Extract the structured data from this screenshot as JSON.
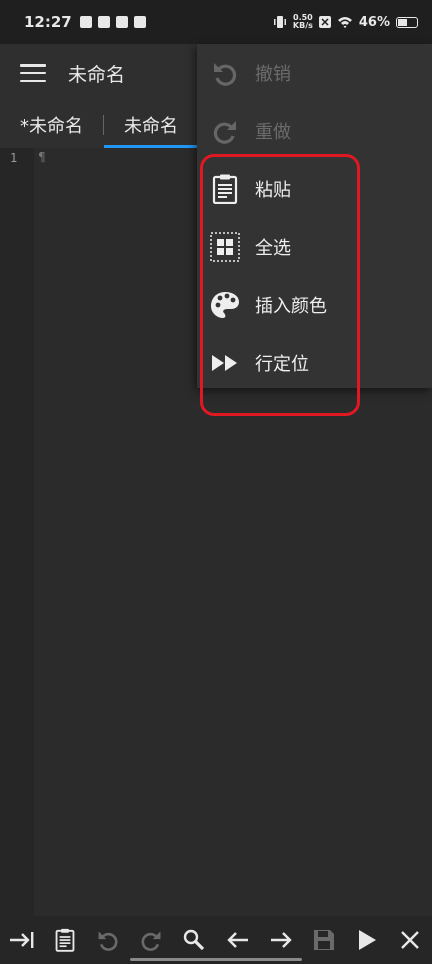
{
  "status_bar": {
    "time": "12:27",
    "speed_value": "0.50",
    "speed_unit": "KB/s",
    "battery": "46%"
  },
  "app_bar": {
    "title": "未命名"
  },
  "tabs": [
    {
      "label": "*未命名",
      "active": false
    },
    {
      "label": "未命名",
      "active": true
    }
  ],
  "editor": {
    "line_number": "1",
    "marker": "¶"
  },
  "menu": {
    "items": [
      {
        "label": "撤销",
        "icon": "undo-icon",
        "enabled": false
      },
      {
        "label": "重做",
        "icon": "redo-icon",
        "enabled": false
      },
      {
        "label": "粘贴",
        "icon": "clipboard-icon",
        "enabled": true
      },
      {
        "label": "全选",
        "icon": "select-all-icon",
        "enabled": true
      },
      {
        "label": "插入颜色",
        "icon": "palette-icon",
        "enabled": true
      },
      {
        "label": "行定位",
        "icon": "fast-forward-icon",
        "enabled": true
      }
    ]
  },
  "toolbar": {
    "items": [
      "tab-key-icon",
      "clipboard-icon",
      "undo-icon",
      "redo-icon",
      "search-icon",
      "arrow-left-icon",
      "arrow-right-icon",
      "save-icon",
      "play-icon",
      "close-icon"
    ]
  },
  "colors": {
    "accent": "#2196f3",
    "highlight": "#e01822",
    "background": "#2b2b2b"
  }
}
